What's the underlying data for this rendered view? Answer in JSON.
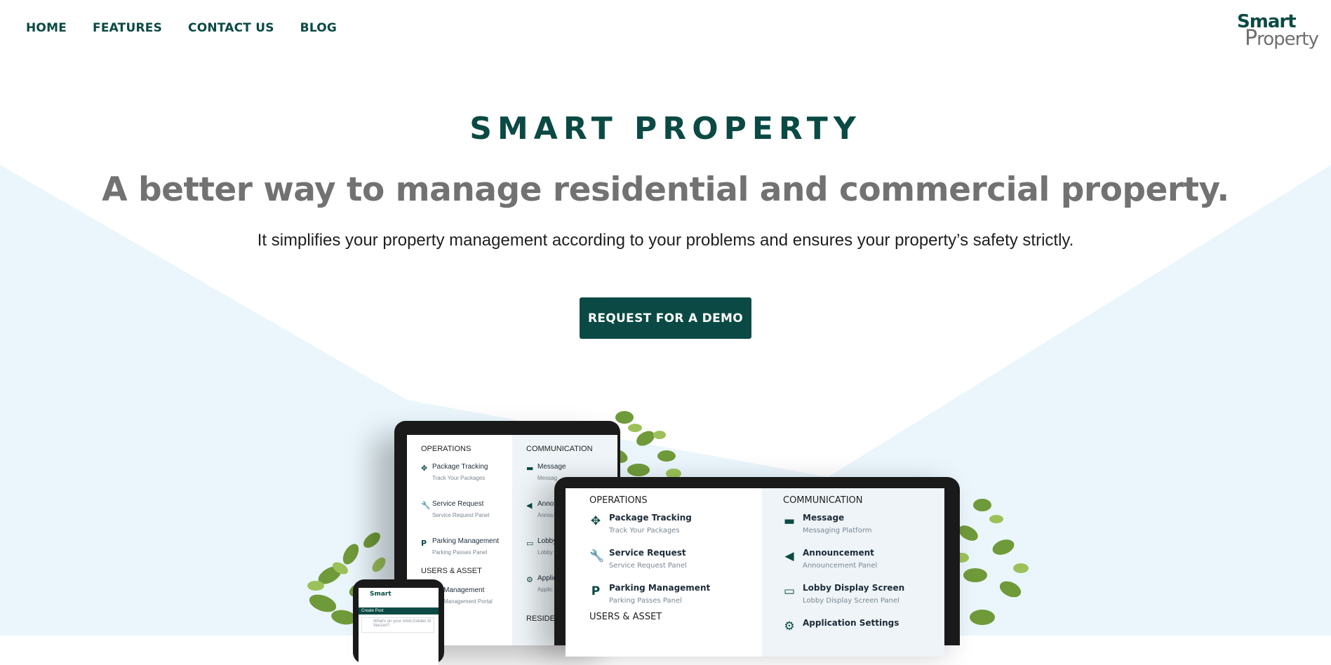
{
  "nav": {
    "links": [
      "HOME",
      "FEATURES",
      "CONTACT US",
      "BLOG"
    ]
  },
  "logo": {
    "top": "Smart",
    "bottom_letter": "P",
    "bottom_rest": "roperty"
  },
  "hero": {
    "brand": "SMART PROPERTY",
    "headline": "A better way to manage residential and commercial property.",
    "subline": "It simplifies your property management according to your problems and ensures your property’s safety strictly.",
    "cta": "REQUEST FOR A DEMO"
  },
  "colors": {
    "brand": "#0b4a44",
    "headline": "#727272",
    "bg_shape": "#eaf6fc"
  },
  "laptop": {
    "left_heading": "OPERATIONS",
    "right_heading": "COMMUNICATION",
    "left_items": [
      {
        "icon": "package-icon",
        "title": "Package Tracking",
        "sub": "Track Your Packages"
      },
      {
        "icon": "wrench-icon",
        "title": "Service Request",
        "sub": "Service Request Panel"
      },
      {
        "icon": "parking-icon",
        "title": "Parking Management",
        "sub": "Parking Passes Panel"
      }
    ],
    "left_heading_2": "USERS & ASSET",
    "right_items": [
      {
        "icon": "message-icon",
        "title": "Message",
        "sub": "Messaging Platform"
      },
      {
        "icon": "megaphone-icon",
        "title": "Announcement",
        "sub": "Announcement Panel"
      },
      {
        "icon": "monitor-icon",
        "title": "Lobby Display Screen",
        "sub": "Lobby Display Screen Panel"
      },
      {
        "icon": "gear-icon",
        "title": "Application Settings",
        "sub": ""
      }
    ]
  },
  "tablet": {
    "left_heading": "OPERATIONS",
    "right_heading": "COMMUNICATION",
    "left_items": [
      {
        "title": "Package Tracking",
        "sub": "Track Your Packages"
      },
      {
        "title": "Service Request",
        "sub": "Service Request Panel"
      },
      {
        "title": "Parking Management",
        "sub": "Parking Passes Panel"
      }
    ],
    "left_heading_2": "USERS & ASSET",
    "left_item_4": {
      "title": "Management",
      "sub": "Management Portal"
    },
    "right_items": [
      {
        "title": "Message",
        "sub": "Messag"
      },
      {
        "title": "Annou",
        "sub": "Annou"
      },
      {
        "title": "Lobby",
        "sub": "Lobby"
      },
      {
        "title": "Applic",
        "sub": "Applic"
      }
    ],
    "right_heading_2": "RESIDENT"
  },
  "phone": {
    "logo": "Smart",
    "bar": "Create Post",
    "post_placeholder": "What's on your mind,Golden Al Vanzan?"
  }
}
